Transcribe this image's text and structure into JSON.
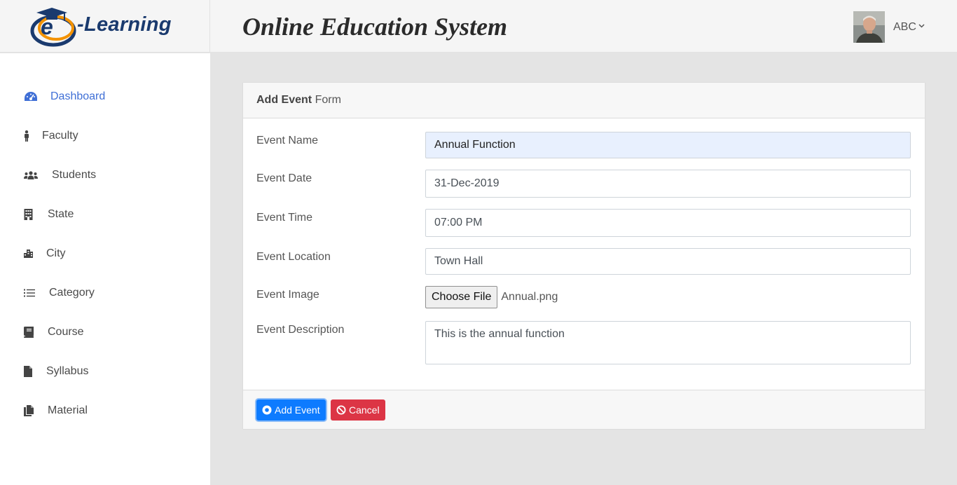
{
  "header": {
    "logo_text": "-Learning",
    "logo_letter": "e",
    "app_title": "Online Education System",
    "user_name": "ABC"
  },
  "sidebar": {
    "items": [
      {
        "label": "Dashboard",
        "icon": "dashboard-icon",
        "active": true
      },
      {
        "label": "Faculty",
        "icon": "person-icon"
      },
      {
        "label": "Students",
        "icon": "users-icon"
      },
      {
        "label": "State",
        "icon": "building-icon"
      },
      {
        "label": "City",
        "icon": "city-icon"
      },
      {
        "label": "Category",
        "icon": "list-icon"
      },
      {
        "label": "Course",
        "icon": "book-icon"
      },
      {
        "label": "Syllabus",
        "icon": "file-icon"
      },
      {
        "label": "Material",
        "icon": "files-icon"
      }
    ]
  },
  "form": {
    "title_bold": "Add Event",
    "title_rest": " Form",
    "fields": {
      "event_name": {
        "label": "Event Name",
        "value": "Annual Function"
      },
      "event_date": {
        "label": "Event Date",
        "value": "31-Dec-2019"
      },
      "event_time": {
        "label": "Event Time",
        "value": "07:00 PM"
      },
      "event_location": {
        "label": "Event Location",
        "value": "Town Hall"
      },
      "event_image": {
        "label": "Event Image",
        "button": "Choose File",
        "file_name": "Annual.png"
      },
      "event_description": {
        "label": "Event Description",
        "value": "This is the annual function"
      }
    },
    "buttons": {
      "submit": "Add Event",
      "cancel": "Cancel"
    }
  },
  "colors": {
    "accent": "#3f6fd6",
    "primary_button": "#0d7bff",
    "danger_button": "#dc3545",
    "logo_blue": "#1a3a6e",
    "logo_orange": "#f39200"
  }
}
